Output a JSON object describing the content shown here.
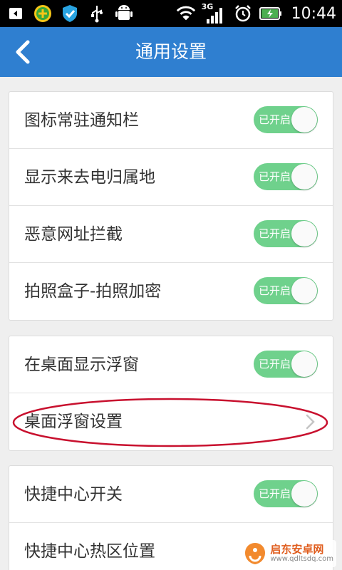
{
  "status_bar": {
    "time": "10:44",
    "network": "3G",
    "icons": [
      "notification-icon",
      "360-security-icon",
      "shield-check-icon",
      "usb-icon",
      "android-debug-icon",
      "wifi-icon",
      "signal-icon",
      "alarm-icon",
      "battery-charging-icon"
    ]
  },
  "header": {
    "title": "通用设置",
    "back_icon": "back-chevron-icon"
  },
  "groups": [
    {
      "items": [
        {
          "label": "图标常驻通知栏",
          "toggle": "已开启"
        },
        {
          "label": "显示来去电归属地",
          "toggle": "已开启"
        },
        {
          "label": "恶意网址拦截",
          "toggle": "已开启"
        },
        {
          "label": "拍照盒子-拍照加密",
          "toggle": "已开启"
        }
      ]
    },
    {
      "items": [
        {
          "label": "在桌面显示浮窗",
          "toggle": "已开启"
        },
        {
          "label": "桌面浮窗设置",
          "arrow_icon": "chevron-right-icon"
        }
      ]
    },
    {
      "items": [
        {
          "label": "快捷中心开关",
          "toggle": "已开启"
        },
        {
          "label": "快捷中心热区位置"
        }
      ]
    }
  ],
  "watermark": {
    "line1": "启东安卓网",
    "line2": "www.qdltsdq.com"
  },
  "colors": {
    "status_bar": "#000000",
    "header": "#2f7fd0",
    "toggle_on": "#6fd18c",
    "background": "#efefef",
    "highlight": "#c8102e"
  }
}
